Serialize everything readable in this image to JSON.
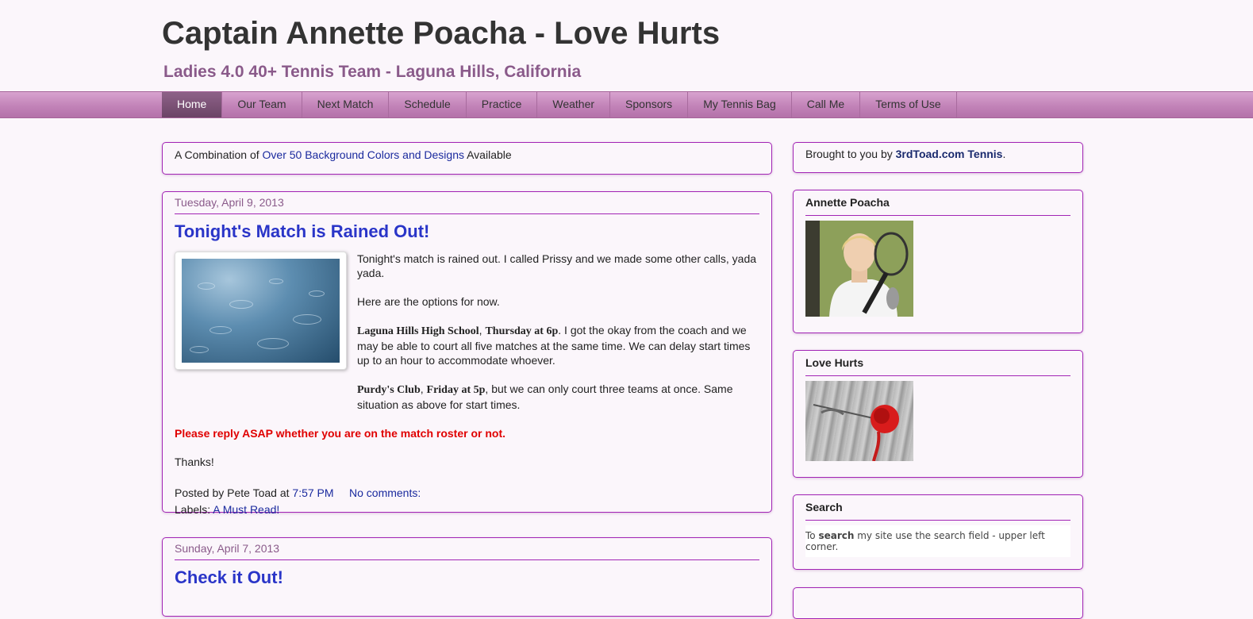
{
  "header": {
    "title": "Captain Annette Poacha - Love Hurts",
    "description": "Ladies 4.0 40+ Tennis Team - Laguna Hills, California"
  },
  "nav": {
    "tabs": [
      "Home",
      "Our Team",
      "Next Match",
      "Schedule",
      "Practice",
      "Weather",
      "Sponsors",
      "My Tennis Bag",
      "Call Me",
      "Terms of Use"
    ],
    "active": "Home"
  },
  "promo": {
    "prefix": "A Combination of ",
    "link": "Over 50 Background Colors and Designs",
    "suffix": " Available"
  },
  "post1": {
    "date": "Tuesday, April 9, 2013",
    "title": "Tonight's Match is Rained Out!",
    "p1": "Tonight's match is rained out. I called Prissy and we made some other calls, yada yada.",
    "p2": "Here are the options for now.",
    "p3_bold1": "Laguna Hills High School",
    "p3_sep": ", ",
    "p3_bold2": "Thursday at 6p",
    "p3_rest": ". I got the okay from the coach and we may be able to court all five matches at the same time. We can delay start times up to an hour to accommodate whoever.",
    "p4_bold1": "Purdy's Club",
    "p4_sep": ", ",
    "p4_bold2": "Friday at 5p",
    "p4_rest": ", but we can only court three teams at once. Same situation as above for start times.",
    "alert": "Please reply ASAP whether you are on the match roster or not.",
    "thanks": "Thanks!",
    "posted_prefix": "Posted by Pete Toad at ",
    "time": "7:57 PM",
    "comments": "No comments:",
    "labels_prefix": "Labels: ",
    "label": "A Must Read!"
  },
  "post2": {
    "date": "Sunday, April 7, 2013",
    "title": "Check it Out!"
  },
  "sidebar": {
    "brought_prefix": "Brought to you by ",
    "brought_link": "3rdToad.com Tennis",
    "brought_suffix": ".",
    "widget1_title": "Annette Poacha",
    "widget2_title": "Love Hurts",
    "widget3_title": "Search",
    "search_prefix": "To ",
    "search_bold": "search",
    "search_rest": " my site use the search field - upper left corner."
  },
  "colors": {
    "background": "#fbf6fb",
    "accent_border": "#a224b5",
    "nav": "#c283b8",
    "post_title": "#2a35c8",
    "alert": "#e00000"
  }
}
